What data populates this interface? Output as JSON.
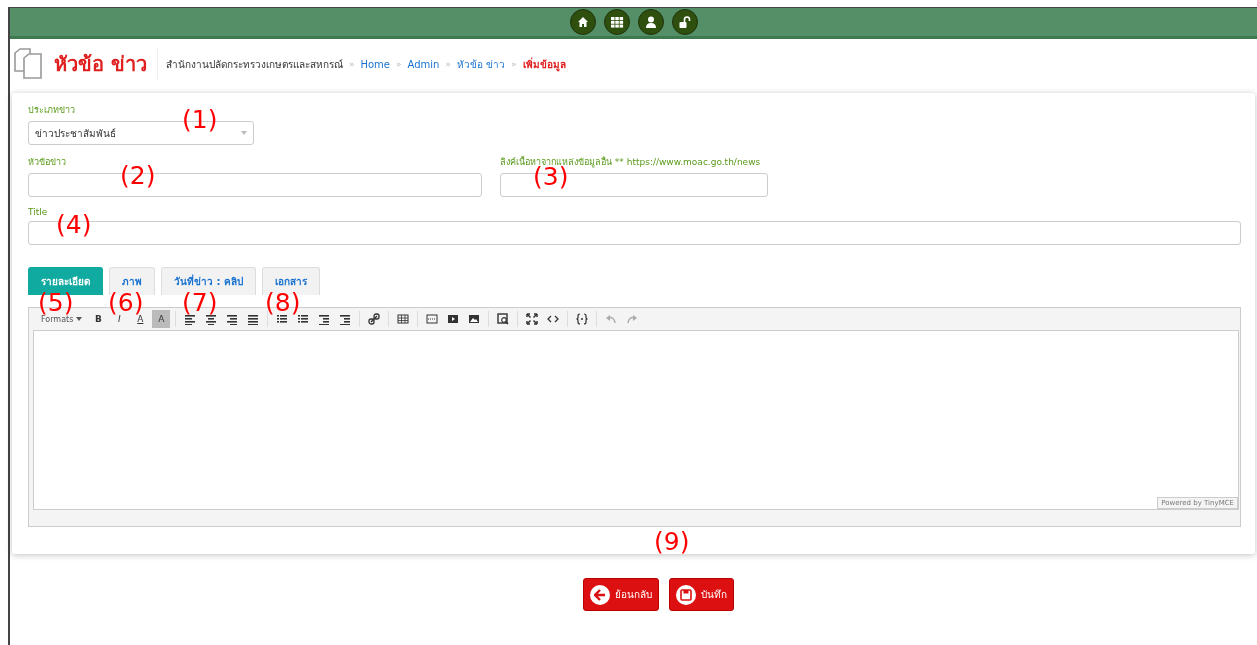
{
  "page_header": {
    "title": "หัวข้อ ข่าว"
  },
  "breadcrumb": [
    {
      "label": "สำนักงานปลัดกระทรวงเกษตรและสหกรณ์",
      "kind": "plain"
    },
    {
      "label": "»",
      "kind": "separator"
    },
    {
      "label": "Home",
      "kind": "link"
    },
    {
      "label": "»",
      "kind": "separator"
    },
    {
      "label": "Admin",
      "kind": "link"
    },
    {
      "label": "»",
      "kind": "separator"
    },
    {
      "label": "หัวข้อ ข่าว",
      "kind": "link"
    },
    {
      "label": "»",
      "kind": "separator"
    },
    {
      "label": "เพิ่มข้อมูล",
      "kind": "current"
    }
  ],
  "form": {
    "news_type": {
      "label": "ประเภทข่าว",
      "value": "ข่าวประชาสัมพันธ์"
    },
    "headline": {
      "label": "หัวข้อข่าว"
    },
    "source_link": {
      "label": "ลิงค์เนื้อหาจากแหล่งข้อมูลอื่น ** https://www.moac.go.th/news"
    },
    "title": {
      "label": "Title"
    }
  },
  "tabs": [
    {
      "label": "รายละเอียด",
      "selected": true
    },
    {
      "label": "ภาพ",
      "selected": false
    },
    {
      "label": "วันที่ข่าว : คลิป",
      "selected": false
    },
    {
      "label": "เอกสาร",
      "selected": false
    }
  ],
  "editor": {
    "toolbar": [
      {
        "kind": "dropdown",
        "label": "Formats"
      },
      {
        "kind": "bold",
        "label": "B"
      },
      {
        "kind": "italic",
        "label": "I"
      },
      {
        "kind": "color",
        "label": "A"
      },
      {
        "kind": "background",
        "label": "A"
      }
    ],
    "footer": "Powered by TinyMCE"
  },
  "buttons": [
    {
      "label": "ย้อนกลับ",
      "kind": "back"
    },
    {
      "label": "บันทึก",
      "kind": "save"
    }
  ],
  "annotations": [
    "(1)",
    "(2)",
    "(3)",
    "(4)",
    "(5)",
    "(6)",
    "(7)",
    "(8)",
    "(9)"
  ]
}
